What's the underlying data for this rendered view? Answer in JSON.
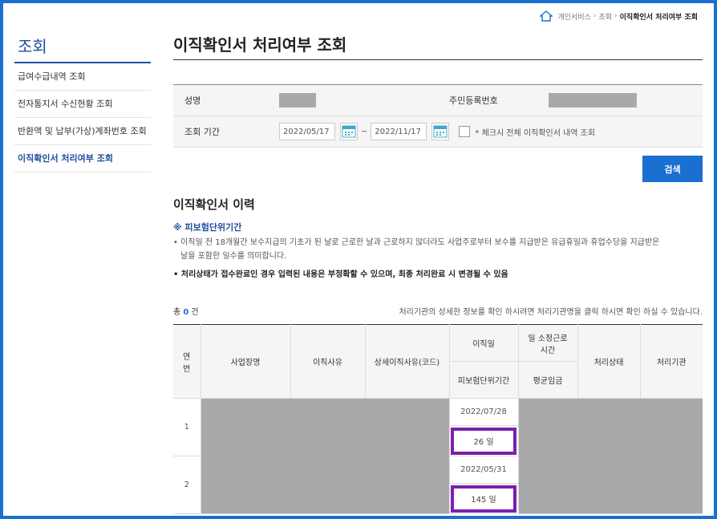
{
  "breadcrumb": {
    "items": [
      "개인서비스",
      "조회"
    ],
    "current": "이직확인서 처리여부 조회"
  },
  "sidebar": {
    "title": "조회",
    "items": [
      {
        "label": "급여수급내역 조회"
      },
      {
        "label": "전자통지서 수신현황 조회"
      },
      {
        "label": "반환액 및 납부(가상)계좌번호 조회"
      },
      {
        "label": "이직확인서 처리여부 조회"
      }
    ]
  },
  "page": {
    "title": "이직확인서 처리여부 조회"
  },
  "form": {
    "name_label": "성명",
    "ssn_label": "주민등록번호",
    "period_label": "조회 기간",
    "start_date": "2022/05/17",
    "end_date": "2022/11/17",
    "tilde": "~",
    "checkbox_label": "* 체크시 전체 이직확인서 내역 조회",
    "search_label": "검색"
  },
  "history": {
    "title": "이직확인서 이력",
    "note_title": "※ 피보험단위기간",
    "note1_line1": "• 이직일 전 18개월간 보수지급의 기초가 된 날로 근로한 날과 근로하지 않더라도 사업주로부터 보수를 지급받은 유급휴일과 휴업수당을 지급받은",
    "note1_line2": "날을 포함한 일수를 의미합니다.",
    "note2": "• 처리상태가 접수완료인 경우 입력된 내용은 부정확할 수 있으며, 최종 처리완료 시 변경될 수 있음",
    "total_prefix": "총",
    "total_count": "0",
    "total_suffix": "건",
    "info": "처리기관의 상세한 정보를 확인 하시려면 처리기관명을 클릭 하시면 확인 하실 수 있습니다."
  },
  "table": {
    "headers": {
      "no_line1": "연",
      "no_line2": "번",
      "company": "사업장명",
      "reason": "이직사유",
      "detail_reason": "상세이직사유(코드)",
      "leave_date": "이직일",
      "insured_period": "피보험단위기간",
      "work_hours_line1": "일 소정근로",
      "work_hours_line2": "시간",
      "avg_wage": "평균임금",
      "status": "처리상태",
      "agency": "처리기관"
    },
    "rows": [
      {
        "no": "1",
        "leave_date": "2022/07/28",
        "insured_period": "26 일"
      },
      {
        "no": "2",
        "leave_date": "2022/05/31",
        "insured_period": "145 일"
      }
    ]
  },
  "colors": {
    "frame": "#1a6fd0",
    "accent": "#1f4e9c",
    "button": "#1a6fd0",
    "highlight": "#7a1fb0",
    "mask": "#a9a9a9"
  }
}
